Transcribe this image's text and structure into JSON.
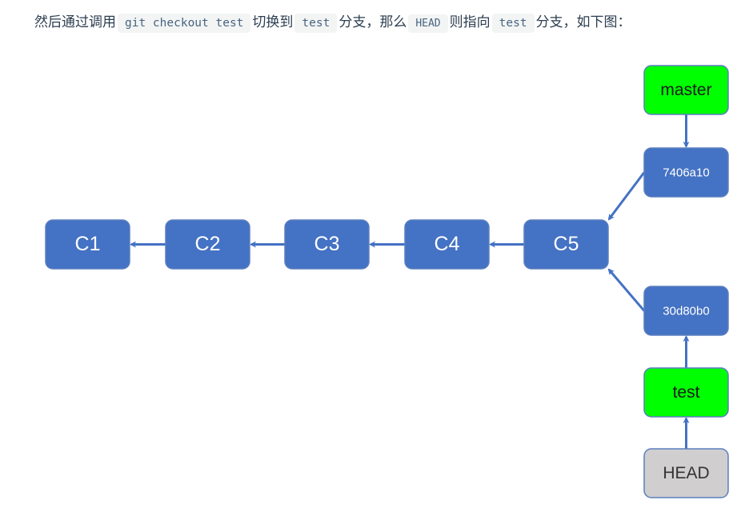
{
  "paragraph": {
    "t1": "然后通过调用",
    "c1": "git checkout test",
    "t2": "切换到",
    "c2": "test",
    "t3": "分支，那么",
    "c3": "HEAD",
    "t4": "则指向",
    "c4": "test",
    "t5": "分支，如下图："
  },
  "diagram": {
    "colors": {
      "commit_fill": "#4472c4",
      "commit_text": "#ffffff",
      "branch_fill": "#00ff00",
      "branch_text": "#1a1a1a",
      "head_fill": "#d0cece",
      "head_text": "#333333",
      "border": "#5b7fbf",
      "arrow": "#4472c4"
    },
    "commits": [
      {
        "id": "c1",
        "label": "C1"
      },
      {
        "id": "c2",
        "label": "C2"
      },
      {
        "id": "c3",
        "label": "C3"
      },
      {
        "id": "c4",
        "label": "C4"
      },
      {
        "id": "c5",
        "label": "C5"
      },
      {
        "id": "h1",
        "label": "7406a10"
      },
      {
        "id": "h2",
        "label": "30d80b0"
      }
    ],
    "branches": [
      {
        "id": "master",
        "label": "master"
      },
      {
        "id": "test",
        "label": "test"
      }
    ],
    "head": {
      "id": "head",
      "label": "HEAD"
    },
    "edges": [
      {
        "from": "c2",
        "to": "c1"
      },
      {
        "from": "c3",
        "to": "c2"
      },
      {
        "from": "c4",
        "to": "c3"
      },
      {
        "from": "c5",
        "to": "c4"
      },
      {
        "from": "h1",
        "to": "c5"
      },
      {
        "from": "h2",
        "to": "c5"
      },
      {
        "from": "master",
        "to": "h1"
      },
      {
        "from": "test",
        "to": "h2"
      },
      {
        "from": "head",
        "to": "test"
      }
    ]
  }
}
